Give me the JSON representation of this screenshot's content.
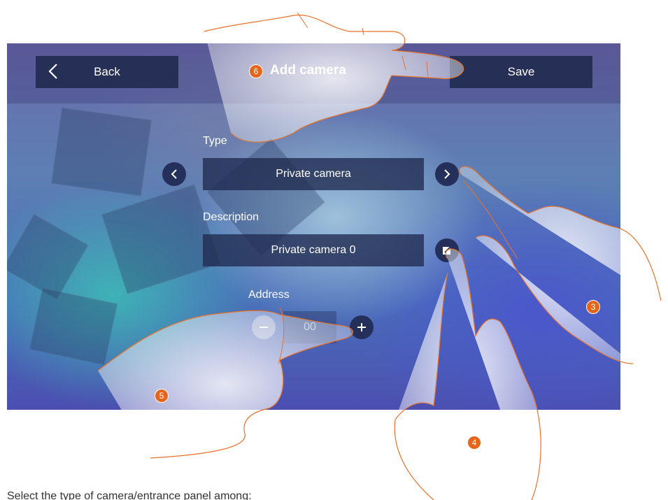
{
  "header": {
    "back_label": "Back",
    "title": "Add camera",
    "save_label": "Save"
  },
  "fields": {
    "type_label": "Type",
    "type_value": "Private camera",
    "description_label": "Description",
    "description_value": "Private camera 0",
    "address_label": "Address",
    "address_value": "00"
  },
  "badges": {
    "title_step": "6",
    "step_3": "3",
    "step_4": "4",
    "step_5": "5"
  },
  "caption": "Select the type of camera/entrance panel among:",
  "colors": {
    "badge": "#e5661b",
    "button_bg": "#262f56",
    "hand_outline": "#e8722a"
  },
  "icons": [
    "back-chevron-icon",
    "chevron-left-icon",
    "chevron-right-icon",
    "edit-icon",
    "minus-icon",
    "plus-icon"
  ]
}
